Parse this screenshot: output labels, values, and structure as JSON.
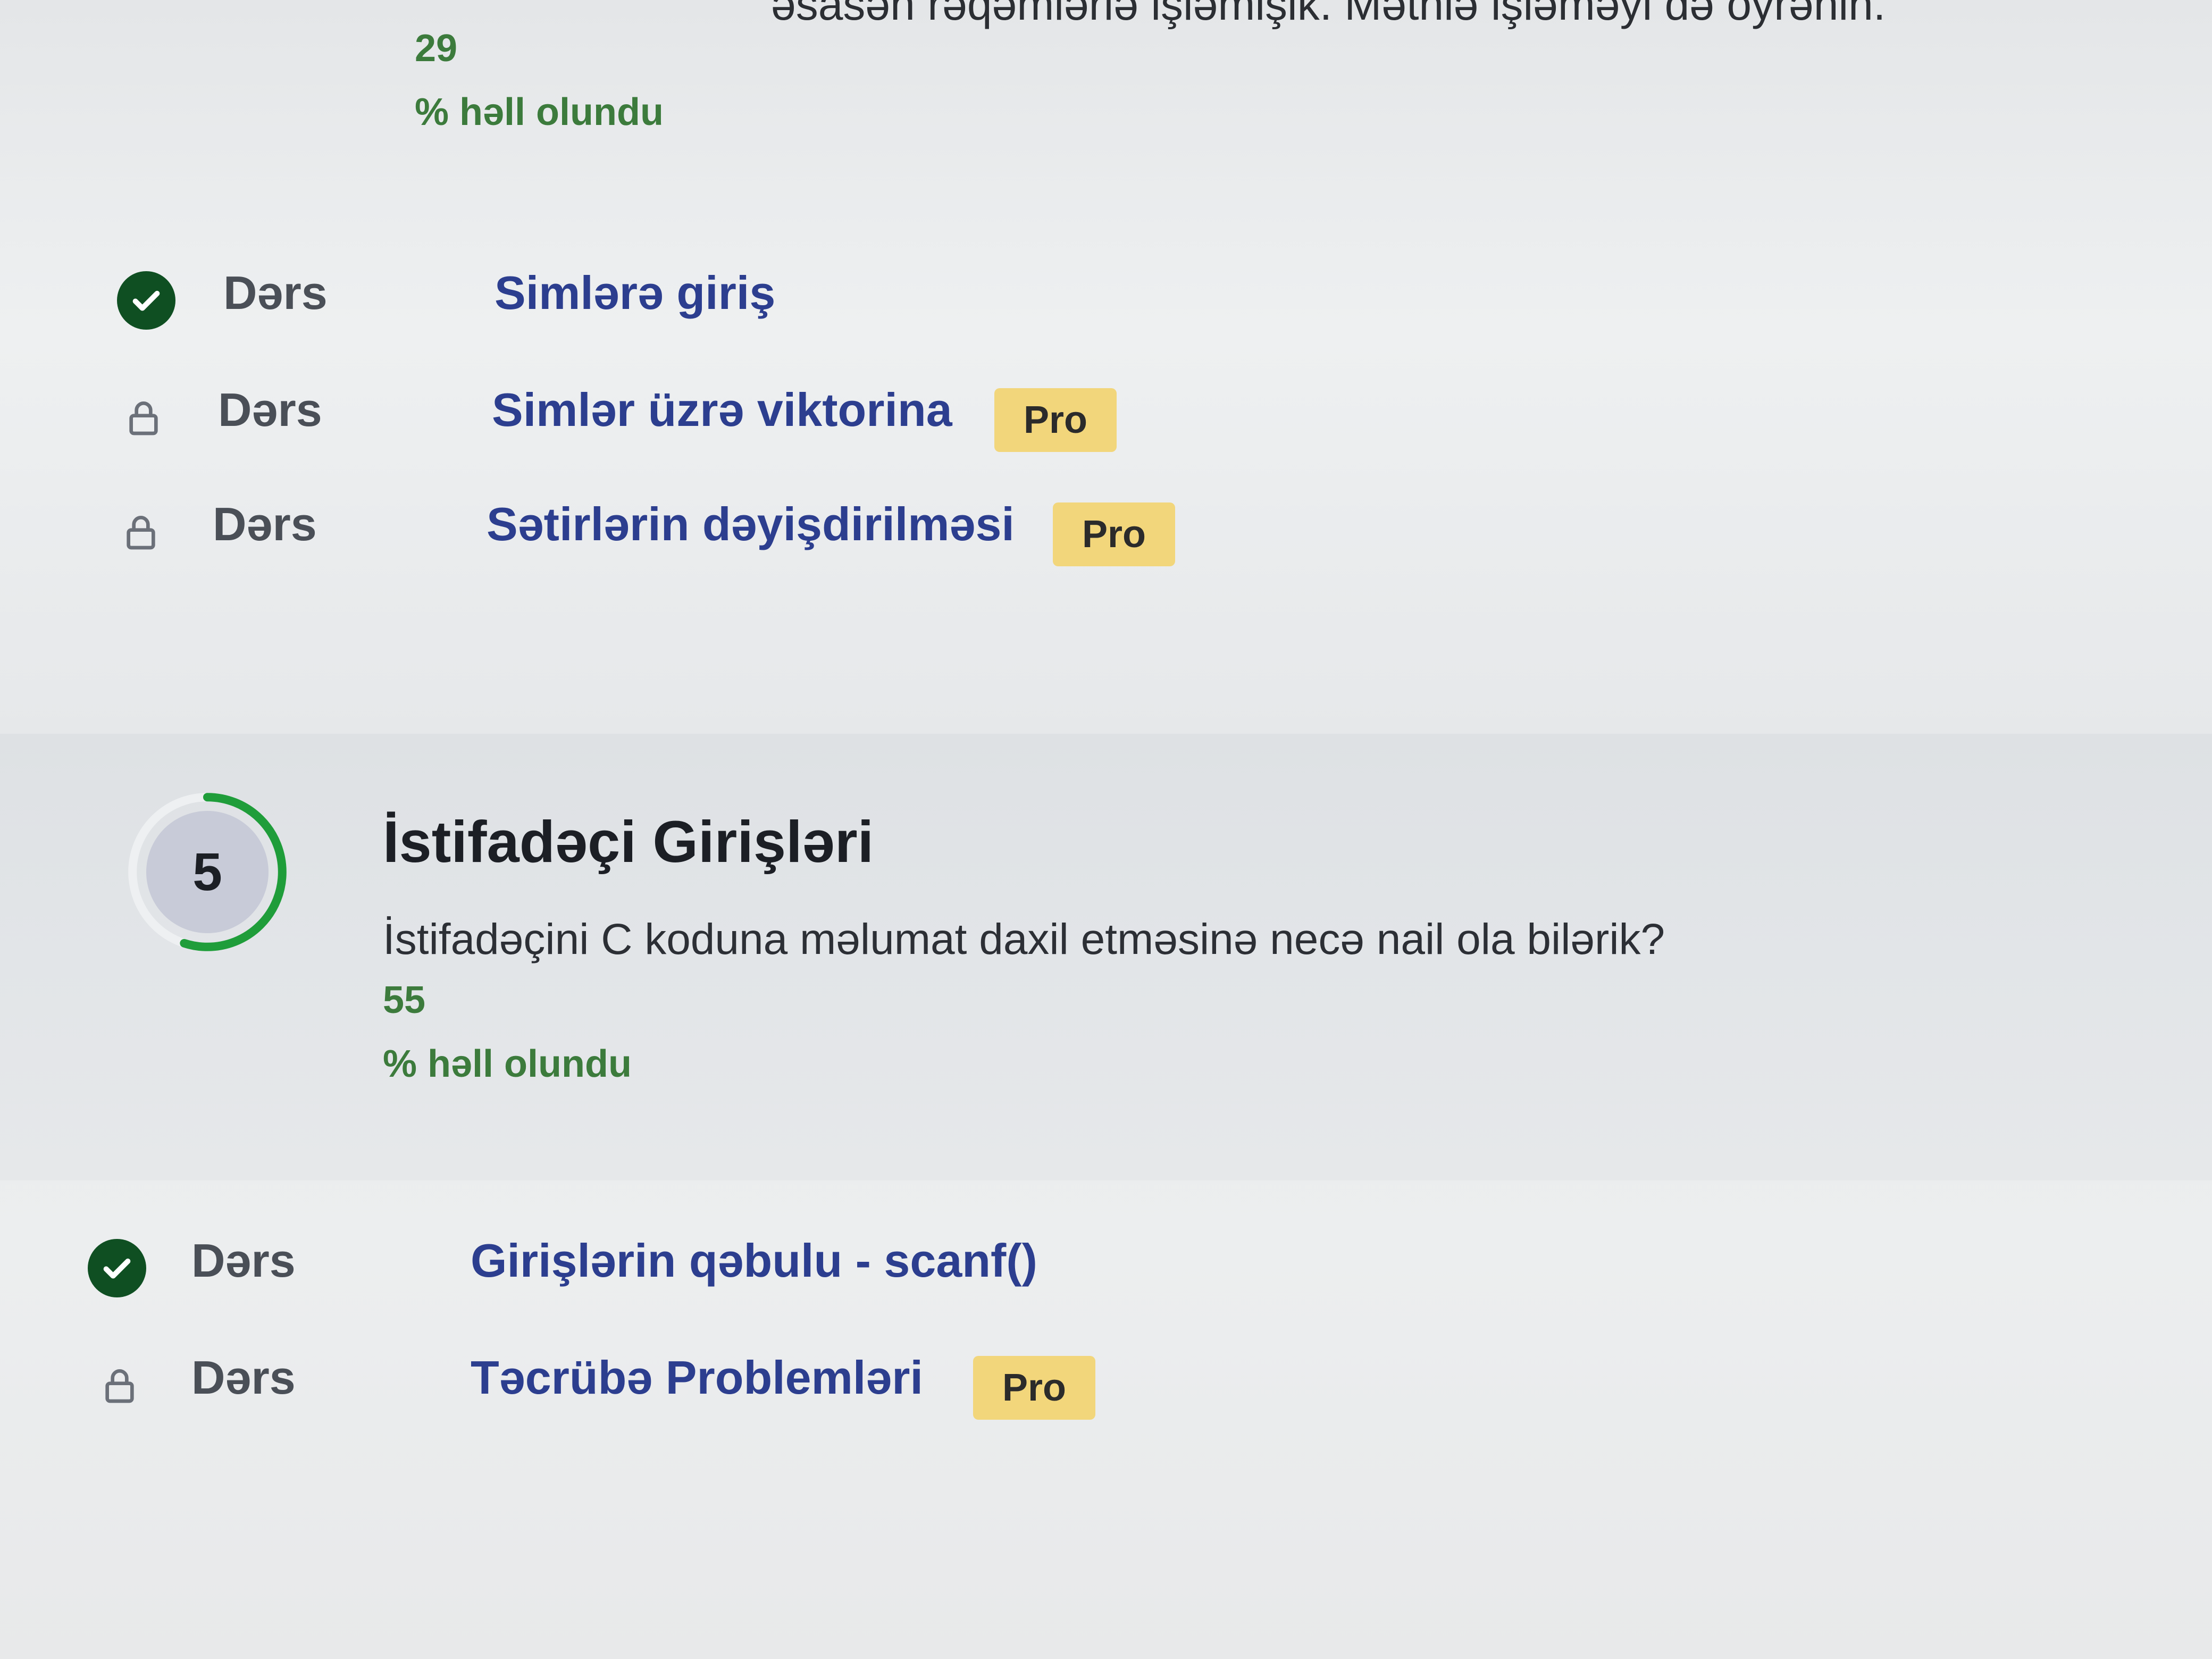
{
  "previous_module": {
    "description_tail": "əsasən rəqəmlərlə işləmişik. Mətnlə işləməyi də öyrənin.",
    "solved_count": "29",
    "solved_label": "% həll olundu",
    "lessons": [
      {
        "type": "Dərs",
        "title": "Simlərə giriş",
        "status": "completed",
        "pro": false
      },
      {
        "type": "Dərs",
        "title": "Simlər üzrə viktorina",
        "status": "locked",
        "pro": true,
        "pro_label": "Pro"
      },
      {
        "type": "Dərs",
        "title": "Sətirlərin dəyişdirilməsi",
        "status": "locked",
        "pro": true,
        "pro_label": "Pro"
      }
    ]
  },
  "module": {
    "number": "5",
    "title": "İstifadəçi Girişləri",
    "description": "İstifadəçini C koduna məlumat daxil etməsinə necə nail ola bilərik?",
    "solved_count": "55",
    "solved_label": "% həll olundu",
    "progress_fraction": 0.55,
    "progress_color": "#1f9d3a",
    "lessons": [
      {
        "type": "Dərs",
        "title": "Girişlərin qəbulu - scanf()",
        "status": "completed",
        "pro": false
      },
      {
        "type": "Dərs",
        "title": "Təcrübə Problemləri",
        "status": "locked",
        "pro": true,
        "pro_label": "Pro"
      }
    ]
  },
  "icons": {
    "completed": "check-circle-icon",
    "locked": "lock-icon"
  },
  "colors": {
    "completed_green": "#0f4f22",
    "link_blue": "#2c3e8f",
    "pro_badge": "#f2d67b",
    "solved_green": "#3c7b3c"
  }
}
